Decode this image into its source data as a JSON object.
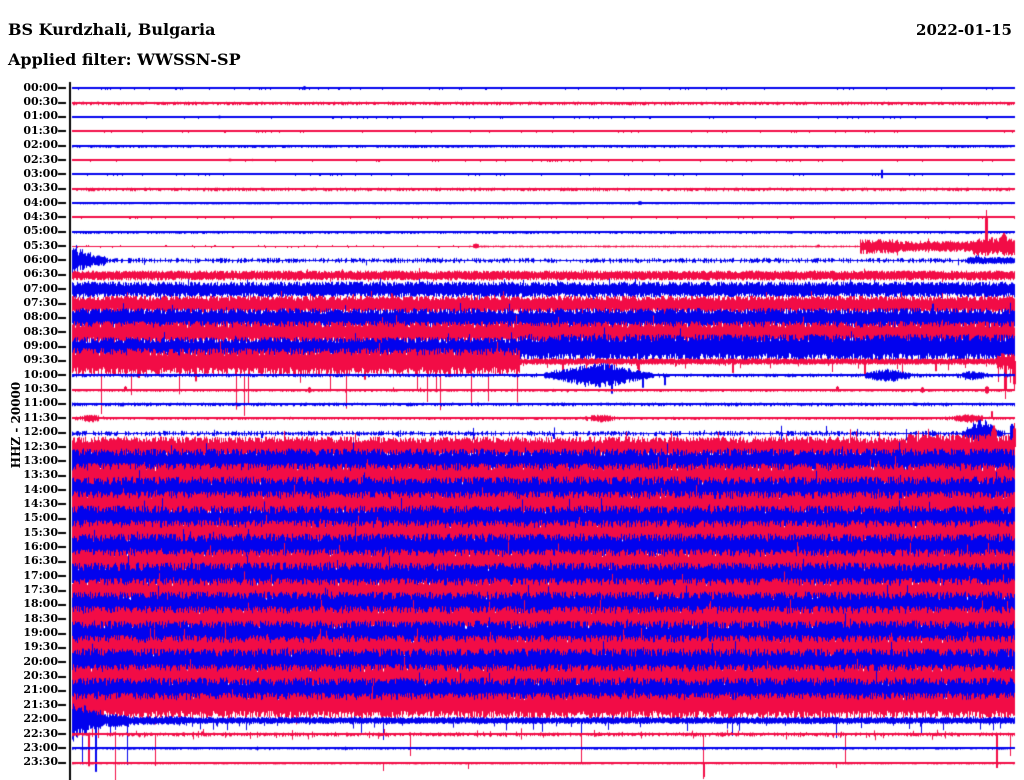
{
  "header": {
    "station_line": "BS Kurdzhali, Bulgaria",
    "filter_line": "Applied filter: WWSSN-SP",
    "date": "2022-01-15"
  },
  "y_axis": {
    "label": "HHZ - 20000"
  },
  "colors": {
    "blue": "#0202ee",
    "red": "#f20c46",
    "axis": "#000000",
    "background": "#ffffff"
  },
  "chart_data": {
    "type": "seismogram-helicorder",
    "station": "BS Kurdzhali, Bulgaria",
    "channel": "HHZ",
    "gain_scale": 20000,
    "date": "2022-01-15",
    "applied_filter": "WWSSN-SP",
    "row_interval_minutes": 30,
    "trace_color_rule": "hour rows blue, half-hour rows red, alternating",
    "notable_events": [
      "small spike 03:00 row near 86% of row",
      "tremor burst 05:30 row from 83% to end with large spike near 97%",
      "burst at start of 06:00 row",
      "high microseismic noise 06:30-09:30",
      "very large saturated red band 09:30 first half, drops after 47%",
      "blue spindle event on 10:00 row near 56%",
      "quiet 10:00-12:00, strong continuous noise 12:30-21:30",
      "decaying burst at start of 22:00 row, long vertical spikes 22:00-23:30"
    ],
    "rows": [
      {
        "t": "00:00",
        "c": "b",
        "segs": [
          [
            0,
            1,
            0.4
          ]
        ],
        "ev": [
          [
            0.245,
            2,
            3,
            "both"
          ]
        ]
      },
      {
        "t": "00:30",
        "c": "r",
        "segs": [
          [
            0,
            1,
            1.4
          ]
        ]
      },
      {
        "t": "01:00",
        "c": "b",
        "segs": [
          [
            0,
            1,
            0.4
          ]
        ],
        "ev": [
          [
            0.155,
            1.5,
            3,
            "both"
          ]
        ]
      },
      {
        "t": "01:30",
        "c": "r",
        "segs": [
          [
            0,
            1,
            0.35
          ]
        ]
      },
      {
        "t": "02:00",
        "c": "b",
        "segs": [
          [
            0,
            1,
            1.1
          ]
        ]
      },
      {
        "t": "02:30",
        "c": "r",
        "segs": [
          [
            0,
            1,
            0.35
          ]
        ],
        "ev": [
          [
            0.165,
            1.5,
            4,
            "both"
          ],
          [
            0.19,
            1.2,
            3,
            "both"
          ]
        ]
      },
      {
        "t": "03:00",
        "c": "b",
        "segs": [
          [
            0,
            1,
            0.4
          ]
        ],
        "ev": [
          [
            0.858,
            5,
            2,
            "both"
          ]
        ]
      },
      {
        "t": "03:30",
        "c": "r",
        "segs": [
          [
            0,
            1,
            1.4
          ]
        ]
      },
      {
        "t": "04:00",
        "c": "b",
        "segs": [
          [
            0,
            1,
            0.45
          ]
        ],
        "ev": [
          [
            0.6,
            2,
            4,
            "both"
          ]
        ]
      },
      {
        "t": "04:30",
        "c": "r",
        "segs": [
          [
            0,
            1,
            0.35
          ]
        ]
      },
      {
        "t": "05:00",
        "c": "b",
        "segs": [
          [
            0,
            1,
            1.1
          ]
        ]
      },
      {
        "t": "05:30",
        "c": "r",
        "segs": [
          [
            0,
            0.42,
            0.4
          ],
          [
            0.42,
            0.835,
            0.55
          ],
          [
            0.835,
            0.875,
            7
          ],
          [
            0.875,
            0.955,
            5
          ],
          [
            0.955,
            1,
            9
          ]
        ],
        "ev": [
          [
            0.425,
            2.5,
            6,
            "both"
          ],
          [
            0.79,
            1.5,
            3,
            "both"
          ],
          [
            0.968,
            36,
            3,
            "up"
          ],
          [
            0.985,
            14,
            6,
            "up"
          ]
        ]
      },
      {
        "t": "06:00",
        "c": "b",
        "segs": [
          [
            0,
            0.006,
            15
          ],
          [
            0.006,
            0.012,
            11
          ],
          [
            0.012,
            0.02,
            8
          ],
          [
            0.02,
            0.035,
            5
          ],
          [
            0.035,
            0.95,
            2.2
          ],
          [
            0.95,
            1,
            3.2
          ]
        ],
        "sp": {
          "prob": 0.015,
          "mult": 3,
          "dir": "down"
        }
      },
      {
        "t": "06:30",
        "c": "r",
        "segs": [
          [
            0,
            1,
            4.5
          ]
        ]
      },
      {
        "t": "07:00",
        "c": "b",
        "segs": [
          [
            0,
            1,
            7.5
          ]
        ]
      },
      {
        "t": "07:30",
        "c": "r",
        "segs": [
          [
            0,
            1,
            8.5
          ]
        ]
      },
      {
        "t": "08:00",
        "c": "b",
        "segs": [
          [
            0,
            1,
            10
          ]
        ]
      },
      {
        "t": "08:30",
        "c": "r",
        "segs": [
          [
            0,
            1,
            11
          ]
        ]
      },
      {
        "t": "09:00",
        "c": "b",
        "segs": [
          [
            0,
            0.475,
            10
          ],
          [
            0.475,
            1,
            13
          ]
        ]
      },
      {
        "t": "09:30",
        "c": "r",
        "segs": [
          [
            0,
            0.475,
            13
          ],
          [
            0.475,
            0.98,
            2.8
          ],
          [
            0.98,
            1,
            8
          ]
        ],
        "sp": {
          "prob": 0.05,
          "mult": 5,
          "dir": "down"
        },
        "ev": [
          [
            0.07,
            20,
            2,
            "down"
          ],
          [
            0.13,
            24,
            2,
            "down"
          ],
          [
            0.2,
            18,
            2,
            "down"
          ],
          [
            0.31,
            22,
            2,
            "down"
          ],
          [
            0.4,
            19,
            2,
            "down"
          ],
          [
            0.52,
            16,
            2,
            "down"
          ],
          [
            0.6,
            20,
            2,
            "down"
          ],
          [
            0.7,
            14,
            2,
            "down"
          ],
          [
            0.84,
            18,
            2,
            "down"
          ],
          [
            0.915,
            12,
            2,
            "down"
          ],
          [
            0.988,
            38,
            3,
            "down"
          ],
          [
            0.998,
            30,
            3,
            "down"
          ]
        ]
      },
      {
        "t": "10:00",
        "c": "b",
        "segs": [
          [
            0,
            1,
            1.4
          ]
        ],
        "sp": {
          "prob": 0.015,
          "mult": 2.5,
          "dir": "both"
        },
        "ev": [
          [
            0.558,
            11,
            26,
            "spindle"
          ],
          [
            0.572,
            22,
            2,
            "down"
          ],
          [
            0.604,
            15,
            2,
            "down"
          ],
          [
            0.628,
            12,
            2,
            "down"
          ],
          [
            0.865,
            5,
            13,
            "spindle"
          ],
          [
            0.955,
            3,
            8,
            "spindle"
          ]
        ]
      },
      {
        "t": "10:30",
        "c": "r",
        "segs": [
          [
            0,
            1,
            1.0
          ]
        ],
        "sp": {
          "prob": 0.02,
          "mult": 3,
          "dir": "both"
        },
        "ev": [
          [
            0.055,
            4,
            3,
            "up"
          ],
          [
            0.25,
            3,
            3,
            "both"
          ],
          [
            0.81,
            4,
            3,
            "up"
          ],
          [
            0.9,
            3,
            3,
            "both"
          ],
          [
            0.968,
            4,
            4,
            "both"
          ]
        ]
      },
      {
        "t": "11:00",
        "c": "b",
        "segs": [
          [
            0,
            1,
            1.5
          ]
        ]
      },
      {
        "t": "11:30",
        "c": "r",
        "segs": [
          [
            0,
            1,
            1.0
          ]
        ],
        "sp": {
          "prob": 0.02,
          "mult": 2,
          "dir": "both"
        },
        "ev": [
          [
            0.02,
            2.5,
            8,
            "spindle"
          ],
          [
            0.56,
            2.5,
            10,
            "spindle"
          ],
          [
            0.95,
            3,
            12,
            "spindle"
          ],
          [
            0.975,
            8,
            2,
            "up"
          ]
        ]
      },
      {
        "t": "12:00",
        "c": "b",
        "segs": [
          [
            0,
            1,
            2.2
          ]
        ],
        "sp": {
          "prob": 0.03,
          "mult": 3.5,
          "dir": "both"
        },
        "ev": [
          [
            0.2,
            6,
            2,
            "down"
          ],
          [
            0.51,
            7,
            2,
            "down"
          ],
          [
            0.965,
            12,
            8,
            "spindle"
          ],
          [
            0.995,
            10,
            4,
            "both"
          ]
        ]
      },
      {
        "t": "12:30",
        "c": "r",
        "segs": [
          [
            0,
            0.885,
            10.5
          ],
          [
            0.885,
            1,
            13
          ]
        ],
        "sp": {
          "prob": 0.01,
          "mult": 1.8,
          "dir": "up"
        },
        "ev": [
          [
            0.975,
            23,
            6,
            "up"
          ],
          [
            0.998,
            24,
            3,
            "up"
          ]
        ]
      },
      {
        "t": "13:00",
        "c": "b",
        "segs": [
          [
            0,
            1,
            12.5
          ]
        ]
      },
      {
        "t": "13:30",
        "c": "r",
        "segs": [
          [
            0,
            1,
            13
          ]
        ]
      },
      {
        "t": "14:00",
        "c": "b",
        "segs": [
          [
            0,
            1,
            13.5
          ]
        ]
      },
      {
        "t": "14:30",
        "c": "r",
        "segs": [
          [
            0,
            1,
            13
          ]
        ]
      },
      {
        "t": "15:00",
        "c": "b",
        "segs": [
          [
            0,
            1,
            13.5
          ]
        ]
      },
      {
        "t": "15:30",
        "c": "r",
        "segs": [
          [
            0,
            1,
            13
          ]
        ]
      },
      {
        "t": "16:00",
        "c": "b",
        "segs": [
          [
            0,
            1,
            13.5
          ]
        ]
      },
      {
        "t": "16:30",
        "c": "r",
        "segs": [
          [
            0,
            1,
            13
          ]
        ]
      },
      {
        "t": "17:00",
        "c": "b",
        "segs": [
          [
            0,
            1,
            13.5
          ]
        ]
      },
      {
        "t": "17:30",
        "c": "r",
        "segs": [
          [
            0,
            1,
            13
          ]
        ]
      },
      {
        "t": "18:00",
        "c": "b",
        "segs": [
          [
            0,
            1,
            13.5
          ]
        ]
      },
      {
        "t": "18:30",
        "c": "r",
        "segs": [
          [
            0,
            1,
            13
          ]
        ]
      },
      {
        "t": "19:00",
        "c": "b",
        "segs": [
          [
            0,
            1,
            13.5
          ]
        ]
      },
      {
        "t": "19:30",
        "c": "r",
        "segs": [
          [
            0,
            1,
            13
          ]
        ]
      },
      {
        "t": "20:00",
        "c": "b",
        "segs": [
          [
            0,
            1,
            13.5
          ]
        ]
      },
      {
        "t": "20:30",
        "c": "r",
        "segs": [
          [
            0,
            1,
            13
          ]
        ]
      },
      {
        "t": "21:00",
        "c": "b",
        "segs": [
          [
            0,
            1,
            13.5
          ]
        ]
      },
      {
        "t": "21:30",
        "c": "r",
        "segs": [
          [
            0,
            1,
            12.5
          ]
        ]
      },
      {
        "t": "22:00",
        "c": "b",
        "segs": [
          [
            0,
            0.006,
            22
          ],
          [
            0.006,
            0.015,
            15
          ],
          [
            0.015,
            0.03,
            10
          ],
          [
            0.03,
            0.06,
            6
          ],
          [
            0.06,
            0.12,
            4
          ],
          [
            0.12,
            1,
            3
          ]
        ],
        "sp": {
          "prob": 0.05,
          "mult": 4,
          "dir": "down"
        },
        "ev": [
          [
            0.024,
            61,
            2,
            "down"
          ],
          [
            0.058,
            45,
            1,
            "down"
          ],
          [
            0.33,
            20,
            1,
            "down"
          ],
          [
            0.54,
            25,
            1,
            "down"
          ],
          [
            0.7,
            16,
            1,
            "down"
          ],
          [
            0.81,
            18,
            1,
            "down"
          ],
          [
            0.9,
            14,
            1,
            "down"
          ]
        ]
      },
      {
        "t": "22:30",
        "c": "r",
        "segs": [
          [
            0,
            1,
            1.6
          ]
        ],
        "sp": {
          "prob": 0.13,
          "mult": 4,
          "dir": "both"
        },
        "ev": [
          [
            0.017,
            38,
            2,
            "down"
          ],
          [
            0.046,
            50,
            1,
            "down"
          ],
          [
            0.088,
            32,
            1,
            "down"
          ],
          [
            0.358,
            22,
            1,
            "down"
          ],
          [
            0.54,
            30,
            1,
            "down"
          ],
          [
            0.669,
            45,
            1,
            "down"
          ],
          [
            0.82,
            28,
            1,
            "down"
          ],
          [
            0.98,
            40,
            2,
            "down"
          ],
          [
            0.995,
            22,
            1,
            "down"
          ]
        ]
      },
      {
        "t": "23:00",
        "c": "b",
        "segs": [
          [
            0,
            1,
            0.8
          ]
        ],
        "sp": {
          "prob": 0.04,
          "mult": 2,
          "dir": "both"
        }
      },
      {
        "t": "23:30",
        "c": "r",
        "segs": [
          [
            0,
            1,
            0.5
          ]
        ],
        "ev": [
          [
            0.33,
            8,
            1,
            "down"
          ],
          [
            0.42,
            6,
            1,
            "down"
          ],
          [
            0.67,
            14,
            1,
            "down"
          ],
          [
            0.81,
            5,
            1,
            "down"
          ]
        ]
      }
    ]
  }
}
